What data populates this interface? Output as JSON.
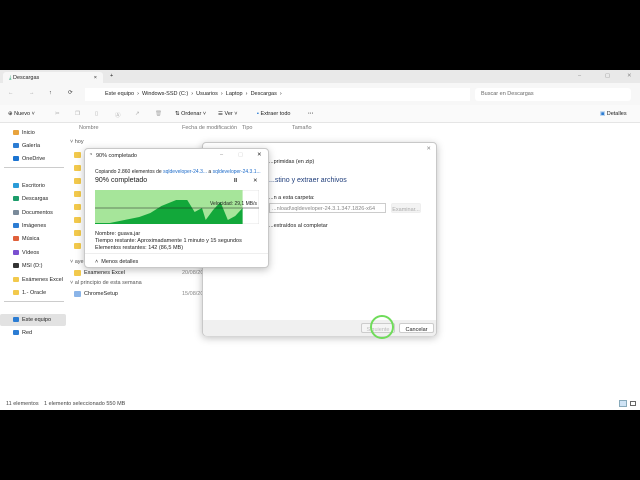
{
  "tab": {
    "title": "Descargas",
    "new_tab": "+",
    "close": "×"
  },
  "window_controls": {
    "minimize": "–",
    "maximize": "▢",
    "close": "✕"
  },
  "nav": {
    "back": "←",
    "forward": "→",
    "up": "↑",
    "refresh": "⟳"
  },
  "breadcrumb": [
    "Este equipo",
    "Windows-SSD (C:)",
    "Usuarios",
    "Laptop",
    "Descargas"
  ],
  "search": {
    "placeholder": "Buscar en Descargas"
  },
  "toolbar": {
    "new": "Nuevo",
    "sort": "Ordenar",
    "view": "Ver",
    "extract_all": "Extraer todo",
    "more": "···",
    "details": "Detalles"
  },
  "columns": {
    "name": "Nombre",
    "date": "Fecha de modificación",
    "type": "Tipo",
    "size": "Tamaño"
  },
  "sidebar": {
    "items": [
      {
        "label": "Inicio",
        "color": "#e8a33d"
      },
      {
        "label": "Galería",
        "color": "#2b7cd3"
      },
      {
        "label": "OneDrive",
        "color": "#1b73d1"
      },
      {
        "label": "Escritorio",
        "color": "#2a9bd8"
      },
      {
        "label": "Descargas",
        "color": "#1c9c6a"
      },
      {
        "label": "Documentos",
        "color": "#7a8a9a"
      },
      {
        "label": "Imágenes",
        "color": "#2b7cd3"
      },
      {
        "label": "Música",
        "color": "#e0603a"
      },
      {
        "label": "Vídeos",
        "color": "#7a4fd0"
      },
      {
        "label": "MSI (D:)",
        "color": "#333333"
      },
      {
        "label": "Exámenes Excel",
        "color": "#f2c94c"
      },
      {
        "label": "1.- Oracle",
        "color": "#f2c94c"
      },
      {
        "label": "Este equipo",
        "color": "#2b7cd3"
      },
      {
        "label": "Red",
        "color": "#2b7cd3"
      }
    ]
  },
  "groups": {
    "today": "hoy",
    "yesterday": "ayer",
    "week": "al principio de esta semana"
  },
  "files": [
    {
      "name": "Examenes Excel",
      "date": "20/08/20"
    },
    {
      "name": "ChromeSetup",
      "date": "15/08/20"
    }
  ],
  "status": {
    "count": "11 elementos",
    "selected": "1 elemento seleccionado  550 MB"
  },
  "extract_dialog": {
    "subtitle": "...primidas (en zip)",
    "heading": "...stino y extraer archivos",
    "folder_label": "...n a esta carpeta:",
    "folder_value": "...nload\\sqldeveloper-24.3.1.347.1826-x64",
    "browse": "Examinar...",
    "show_files": "...extraídos al completar",
    "next": "Siguiente",
    "cancel": "Cancelar",
    "close": "✕"
  },
  "copy_dialog": {
    "title": "90% completado",
    "copying_prefix": "Copiando 2.860 elementos de ",
    "source": "sqldeveloper-24.3...",
    "to": " a ",
    "dest": "sqldeveloper-24.3.1...",
    "progress_text": "90% completado",
    "progress": 0.9,
    "pause": "II",
    "cancel": "✕",
    "speed": "Velocidad: 29,1 MB/s",
    "name": "Nombre: guava.jar",
    "time_left": "Tiempo restante: Aproximadamente 1 minuto y 15 segundos",
    "items_left": "Elementos restantes: 142 (86,5 MB)",
    "less_details": "Menos detalles",
    "minimize": "–",
    "maximize": "▢",
    "close": "✕"
  }
}
